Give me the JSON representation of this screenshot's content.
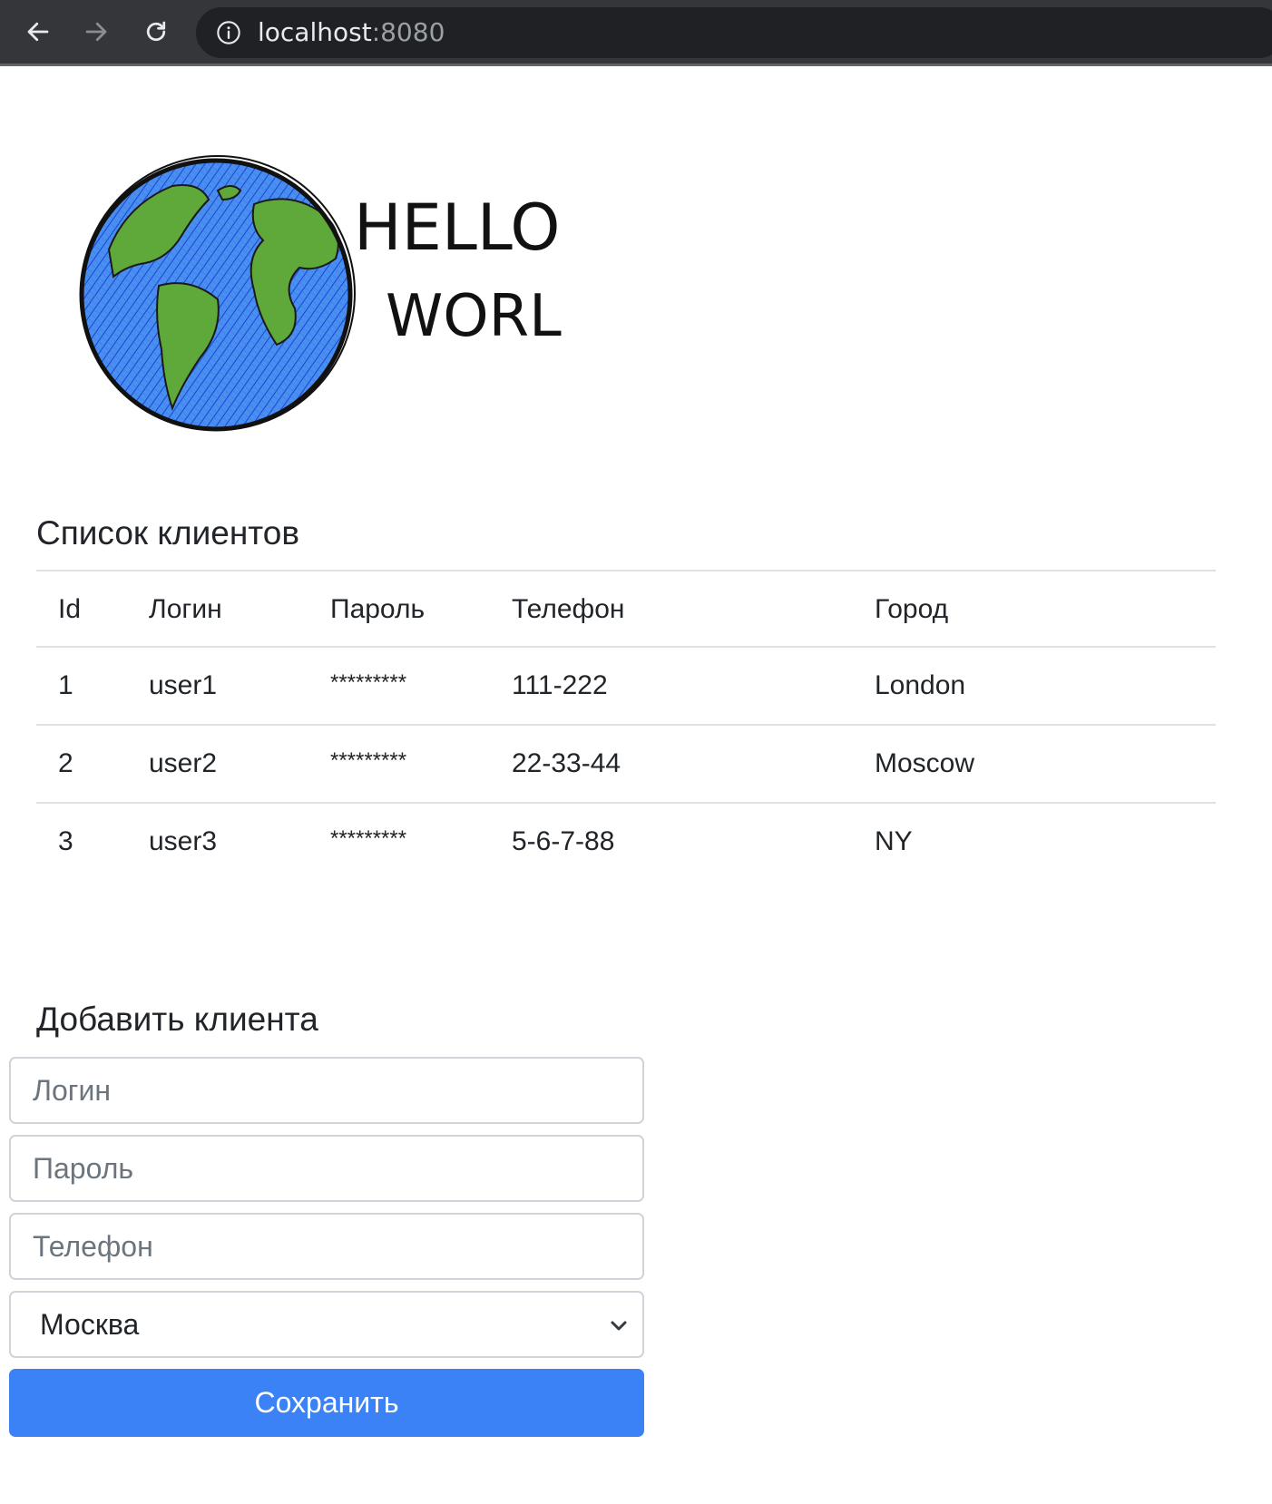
{
  "browser": {
    "url_host": "localhost",
    "url_port": ":8080"
  },
  "logo": {
    "line1": "HELLO",
    "line2": "WORLD!"
  },
  "clients": {
    "title": "Список клиентов",
    "columns": [
      "Id",
      "Логин",
      "Пароль",
      "Телефон",
      "Город"
    ],
    "rows": [
      [
        "1",
        "user1",
        "*********",
        "111-222",
        "London"
      ],
      [
        "2",
        "user2",
        "*********",
        "22-33-44",
        "Moscow"
      ],
      [
        "3",
        "user3",
        "*********",
        "5-6-7-88",
        "NY"
      ]
    ]
  },
  "form": {
    "title": "Добавить клиента",
    "login_placeholder": "Логин",
    "password_placeholder": "Пароль",
    "phone_placeholder": "Телефон",
    "city_selected": "Москва",
    "save_label": "Сохранить"
  },
  "colors": {
    "chrome": "#35363a",
    "omnibox": "#202124",
    "accent": "#3b82f6"
  }
}
